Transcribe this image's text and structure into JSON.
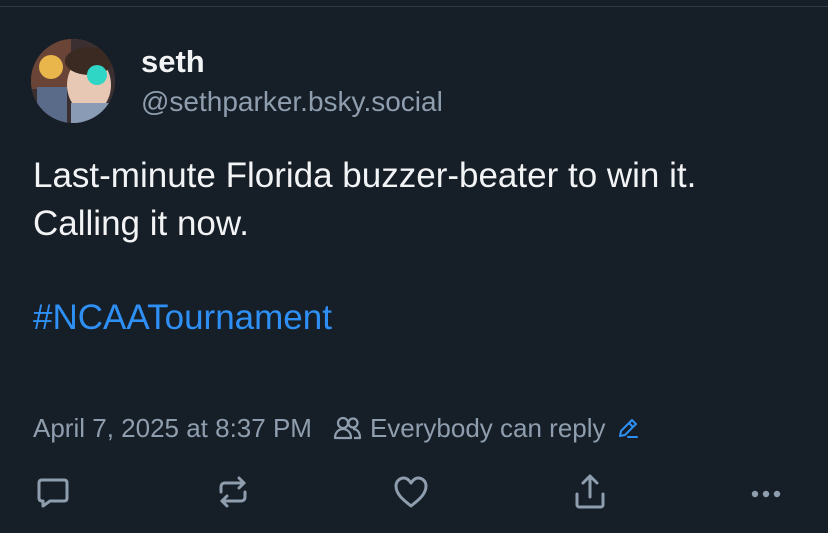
{
  "post": {
    "author": {
      "display_name": "seth",
      "handle": "@sethparker.bsky.social",
      "avatar_icon": "user-avatar"
    },
    "text_lines": [
      "Last-minute Florida buzzer-beater to win it.",
      "Calling it now."
    ],
    "hashtag": "#NCAATournament",
    "timestamp": "April 7, 2025 at 8:37 PM",
    "reply_setting": "Everybody can reply"
  },
  "actions": [
    {
      "name": "reply",
      "icon": "comment-icon"
    },
    {
      "name": "repost",
      "icon": "repost-icon"
    },
    {
      "name": "like",
      "icon": "heart-icon"
    },
    {
      "name": "share",
      "icon": "share-icon"
    },
    {
      "name": "more",
      "icon": "more-icon"
    }
  ],
  "colors": {
    "background": "#161e27",
    "text": "#f1f3f5",
    "muted": "#8f9eae",
    "link": "#2e8ff5"
  }
}
